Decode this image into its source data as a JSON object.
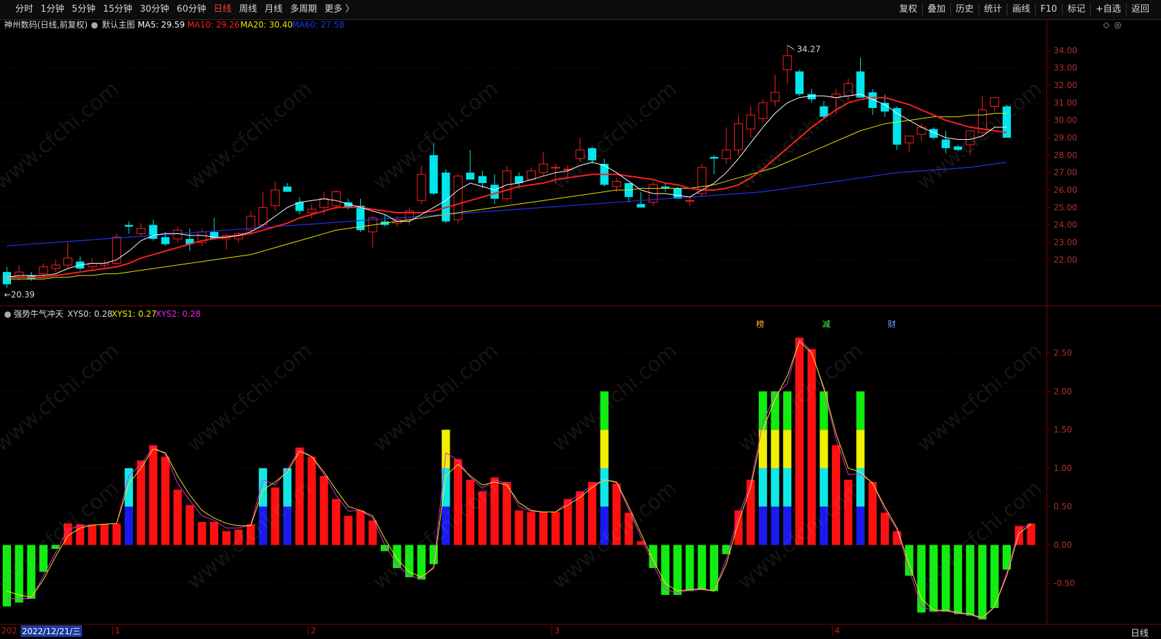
{
  "toolbar": {
    "periods": [
      "分时",
      "1分钟",
      "5分钟",
      "15分钟",
      "30分钟",
      "60分钟",
      "日线",
      "周线",
      "月线",
      "多周期",
      "更多 〉"
    ],
    "active_period": "日线",
    "tools": [
      "复权",
      "叠加",
      "历史",
      "统计",
      "画线",
      "F10",
      "标记",
      "+自选",
      "返回"
    ]
  },
  "main_legend": {
    "stock": "神州数码(日线,前复权)",
    "template": "默认主图",
    "ma5": "MA5: 29.59",
    "ma10": "MA10: 29.26",
    "ma20": "MA20: 30.40",
    "ma60": "MA60: 27.58"
  },
  "sub_legend": {
    "name": "强势牛气冲天",
    "xys0": "XYS0: 0.28",
    "xys1": "XYS1: 0.27",
    "xys2": "XYS2: 0.28"
  },
  "annotations": {
    "high": "34.27",
    "low": "20.39",
    "events": [
      "榜",
      "减",
      "财"
    ]
  },
  "bottom": {
    "date_label": "2022/12/21/三",
    "year_prefix": "202",
    "month_marks": [
      "1",
      "2",
      "3",
      "4"
    ],
    "period_label": "日线"
  },
  "watermark": "www.cfchi.com",
  "colors": {
    "up": "#ff2020",
    "down": "#00e5ee",
    "ma5": "#ffffff",
    "ma10": "#ff2020",
    "ma20": "#e8e800",
    "ma60": "#2233ee",
    "grid": "#6a0000"
  },
  "chart_data": [
    {
      "type": "candlestick",
      "title": "神州数码(日线,前复权)",
      "ylim": [
        20.0,
        35.0
      ],
      "yticks": [
        22.0,
        23.0,
        24.0,
        25.0,
        26.0,
        27.0,
        28.0,
        29.0,
        30.0,
        31.0,
        32.0,
        33.0,
        34.0
      ],
      "month_boundaries": [
        {
          "label": "1",
          "index": 9
        },
        {
          "label": "2",
          "index": 25
        },
        {
          "label": "3",
          "index": 45
        },
        {
          "label": "4",
          "index": 68
        }
      ],
      "ohlc": [
        [
          21.3,
          21.6,
          20.4,
          20.6
        ],
        [
          21.0,
          21.7,
          20.8,
          21.3
        ],
        [
          21.1,
          21.3,
          20.8,
          20.9
        ],
        [
          21.2,
          21.8,
          21.0,
          21.6
        ],
        [
          21.5,
          22.0,
          21.3,
          21.7
        ],
        [
          21.7,
          23.0,
          21.5,
          22.1
        ],
        [
          21.9,
          22.2,
          21.4,
          21.5
        ],
        [
          21.6,
          22.1,
          21.4,
          21.8
        ],
        [
          21.7,
          22.0,
          21.5,
          21.8
        ],
        [
          21.8,
          23.5,
          21.7,
          23.3
        ],
        [
          24.0,
          24.2,
          23.5,
          23.9
        ],
        [
          23.5,
          24.1,
          23.4,
          23.8
        ],
        [
          24.0,
          24.3,
          23.1,
          23.2
        ],
        [
          23.3,
          23.6,
          22.8,
          22.9
        ],
        [
          23.2,
          23.9,
          23.0,
          23.7
        ],
        [
          23.2,
          23.8,
          22.5,
          22.9
        ],
        [
          23.0,
          23.8,
          22.8,
          23.6
        ],
        [
          23.6,
          24.4,
          23.3,
          23.2
        ],
        [
          23.2,
          23.5,
          22.6,
          23.4
        ],
        [
          23.2,
          23.6,
          23.0,
          23.5
        ],
        [
          23.7,
          24.8,
          23.5,
          24.5
        ],
        [
          24.0,
          25.9,
          23.9,
          25.0
        ],
        [
          25.1,
          26.5,
          24.8,
          26.0
        ],
        [
          26.2,
          26.4,
          25.9,
          25.9
        ],
        [
          25.3,
          25.6,
          24.6,
          24.8
        ],
        [
          24.7,
          25.2,
          24.4,
          24.9
        ],
        [
          25.0,
          25.9,
          24.6,
          25.5
        ],
        [
          25.1,
          26.0,
          24.9,
          25.9
        ],
        [
          25.3,
          25.5,
          24.9,
          25.0
        ],
        [
          25.1,
          25.5,
          23.6,
          23.7
        ],
        [
          23.6,
          24.5,
          22.7,
          24.4
        ],
        [
          24.2,
          24.6,
          23.9,
          24.0
        ],
        [
          24.1,
          24.5,
          23.9,
          24.3
        ],
        [
          24.3,
          25.0,
          24.0,
          24.8
        ],
        [
          25.4,
          27.4,
          25.2,
          26.9
        ],
        [
          28.0,
          28.7,
          25.7,
          25.8
        ],
        [
          27.0,
          27.2,
          24.1,
          24.2
        ],
        [
          24.3,
          26.9,
          24.1,
          26.8
        ],
        [
          27.0,
          28.3,
          26.7,
          26.6
        ],
        [
          26.8,
          27.1,
          26.1,
          26.4
        ],
        [
          26.3,
          26.9,
          25.2,
          25.5
        ],
        [
          25.5,
          27.4,
          25.3,
          27.1
        ],
        [
          26.8,
          27.0,
          26.1,
          26.4
        ],
        [
          26.6,
          27.3,
          26.5,
          27.1
        ],
        [
          27.0,
          28.2,
          26.8,
          27.5
        ],
        [
          27.3,
          27.5,
          26.4,
          27.3
        ],
        [
          27.2,
          27.4,
          26.7,
          27.2
        ],
        [
          27.8,
          29.0,
          27.6,
          28.3
        ],
        [
          28.4,
          28.5,
          27.5,
          27.7
        ],
        [
          27.5,
          27.8,
          26.2,
          26.3
        ],
        [
          26.2,
          26.7,
          25.9,
          26.5
        ],
        [
          26.4,
          26.4,
          25.3,
          25.6
        ],
        [
          25.2,
          25.9,
          25.0,
          25.0
        ],
        [
          25.3,
          26.5,
          25.1,
          26.3
        ],
        [
          26.2,
          26.4,
          25.9,
          26.1
        ],
        [
          26.1,
          26.2,
          25.5,
          25.5
        ],
        [
          25.4,
          25.6,
          25.1,
          25.4
        ],
        [
          25.8,
          27.5,
          25.6,
          27.3
        ],
        [
          27.9,
          28.0,
          26.9,
          27.8
        ],
        [
          27.8,
          29.6,
          27.5,
          28.3
        ],
        [
          28.3,
          30.3,
          28.0,
          29.8
        ],
        [
          29.5,
          30.8,
          29.0,
          30.3
        ],
        [
          30.1,
          31.2,
          29.9,
          31.0
        ],
        [
          31.1,
          32.6,
          30.8,
          31.6
        ],
        [
          32.9,
          34.3,
          32.1,
          33.7
        ],
        [
          32.8,
          32.9,
          31.4,
          31.5
        ],
        [
          31.5,
          31.8,
          31.0,
          31.2
        ],
        [
          30.8,
          31.1,
          30.1,
          30.2
        ],
        [
          31.3,
          31.8,
          30.4,
          31.5
        ],
        [
          31.4,
          32.4,
          31.2,
          32.1
        ],
        [
          32.8,
          33.6,
          31.4,
          31.3
        ],
        [
          31.6,
          31.8,
          30.3,
          30.7
        ],
        [
          31.0,
          31.5,
          30.2,
          30.5
        ],
        [
          30.7,
          30.8,
          28.3,
          28.6
        ],
        [
          28.7,
          29.0,
          28.2,
          29.1
        ],
        [
          29.2,
          29.8,
          28.8,
          29.6
        ],
        [
          29.5,
          29.6,
          28.9,
          29.0
        ],
        [
          28.9,
          29.4,
          28.1,
          28.4
        ],
        [
          28.5,
          28.6,
          28.2,
          28.3
        ],
        [
          28.6,
          29.4,
          28.0,
          29.4
        ],
        [
          29.3,
          31.4,
          29.1,
          30.6
        ],
        [
          30.8,
          31.3,
          30.5,
          31.3
        ],
        [
          30.8,
          30.9,
          29.0,
          29.0
        ]
      ],
      "ma5": [
        21.0,
        21.1,
        21.1,
        21.1,
        21.2,
        21.5,
        21.7,
        21.8,
        21.8,
        22.0,
        22.5,
        23.1,
        23.4,
        23.5,
        23.5,
        23.4,
        23.4,
        23.3,
        23.3,
        23.4,
        23.6,
        24.0,
        24.5,
        25.0,
        25.3,
        25.4,
        25.5,
        25.4,
        25.2,
        25.0,
        24.8,
        24.6,
        24.2,
        24.2,
        24.6,
        25.0,
        25.4,
        26.0,
        26.4,
        26.2,
        26.0,
        26.3,
        26.4,
        26.6,
        26.8,
        27.0,
        27.1,
        27.4,
        27.6,
        27.4,
        27.0,
        26.5,
        26.0,
        25.8,
        25.8,
        25.7,
        25.6,
        26.0,
        26.4,
        27.0,
        27.8,
        28.7,
        29.6,
        30.4,
        31.0,
        31.3,
        31.4,
        31.4,
        31.3,
        31.4,
        31.5,
        31.2,
        30.9,
        30.4,
        30.0,
        29.6,
        29.3,
        29.0,
        28.9,
        28.9,
        29.1,
        29.6,
        29.6
      ],
      "ma10": [
        21.0,
        21.0,
        21.0,
        21.0,
        21.1,
        21.2,
        21.3,
        21.4,
        21.5,
        21.6,
        21.8,
        22.1,
        22.3,
        22.5,
        22.7,
        22.9,
        23.1,
        23.2,
        23.3,
        23.4,
        23.5,
        23.7,
        23.9,
        24.1,
        24.4,
        24.6,
        24.8,
        25.0,
        25.0,
        25.0,
        24.9,
        24.8,
        24.7,
        24.7,
        24.7,
        24.8,
        25.0,
        25.2,
        25.4,
        25.6,
        25.8,
        26.0,
        26.2,
        26.3,
        26.4,
        26.6,
        26.7,
        26.8,
        26.9,
        26.9,
        26.9,
        26.8,
        26.7,
        26.6,
        26.4,
        26.3,
        26.1,
        26.0,
        26.0,
        26.1,
        26.3,
        26.7,
        27.2,
        27.8,
        28.4,
        29.0,
        29.6,
        30.1,
        30.6,
        31.0,
        31.2,
        31.3,
        31.3,
        31.1,
        30.9,
        30.6,
        30.3,
        30.0,
        29.8,
        29.6,
        29.5,
        29.4,
        29.3
      ],
      "ma20": [
        20.9,
        20.9,
        20.9,
        20.9,
        21.0,
        21.0,
        21.1,
        21.1,
        21.2,
        21.2,
        21.3,
        21.4,
        21.5,
        21.6,
        21.7,
        21.8,
        21.9,
        22.0,
        22.1,
        22.2,
        22.3,
        22.5,
        22.7,
        22.9,
        23.1,
        23.3,
        23.5,
        23.7,
        23.8,
        23.9,
        24.0,
        24.1,
        24.2,
        24.3,
        24.4,
        24.5,
        24.6,
        24.7,
        24.8,
        24.9,
        25.0,
        25.1,
        25.2,
        25.3,
        25.4,
        25.5,
        25.6,
        25.7,
        25.8,
        25.9,
        26.0,
        26.0,
        26.1,
        26.1,
        26.1,
        26.1,
        26.1,
        26.2,
        26.3,
        26.5,
        26.7,
        26.9,
        27.1,
        27.3,
        27.6,
        27.9,
        28.2,
        28.5,
        28.8,
        29.1,
        29.4,
        29.6,
        29.8,
        29.9,
        30.0,
        30.1,
        30.2,
        30.2,
        30.2,
        30.3,
        30.3,
        30.4,
        30.4
      ],
      "ma60": [
        22.8,
        22.85,
        22.9,
        22.95,
        23.0,
        23.05,
        23.1,
        23.15,
        23.2,
        23.25,
        23.3,
        23.35,
        23.4,
        23.45,
        23.5,
        23.55,
        23.6,
        23.65,
        23.7,
        23.75,
        23.8,
        23.85,
        23.9,
        23.95,
        24.0,
        24.05,
        24.1,
        24.15,
        24.2,
        24.25,
        24.3,
        24.35,
        24.4,
        24.45,
        24.5,
        24.55,
        24.6,
        24.65,
        24.7,
        24.75,
        24.8,
        24.85,
        24.9,
        24.95,
        25.0,
        25.05,
        25.1,
        25.15,
        25.2,
        25.25,
        25.3,
        25.35,
        25.4,
        25.45,
        25.5,
        25.55,
        25.6,
        25.65,
        25.7,
        25.75,
        25.8,
        25.85,
        25.9,
        26.0,
        26.1,
        26.2,
        26.3,
        26.4,
        26.5,
        26.6,
        26.7,
        26.8,
        26.9,
        27.0,
        27.05,
        27.1,
        27.15,
        27.2,
        27.25,
        27.3,
        27.4,
        27.5,
        27.58
      ]
    },
    {
      "type": "bar",
      "title": "强势牛气冲天",
      "ylim": [
        -1.0,
        2.9
      ],
      "yticks": [
        -0.5,
        0.0,
        0.5,
        1.0,
        1.5,
        2.0,
        2.5
      ],
      "xys0": [
        -0.8,
        -0.75,
        -0.7,
        -0.35,
        -0.05,
        0.28,
        0.27,
        0.26,
        0.27,
        0.28,
        1.0,
        1.1,
        1.3,
        1.15,
        0.72,
        0.52,
        0.3,
        0.3,
        0.18,
        0.2,
        0.27,
        1.0,
        0.75,
        1.0,
        1.27,
        1.15,
        0.9,
        0.6,
        0.38,
        0.45,
        0.32,
        -0.08,
        -0.3,
        -0.42,
        -0.45,
        -0.25,
        1.5,
        1.12,
        0.85,
        0.7,
        0.88,
        0.82,
        0.45,
        0.43,
        0.43,
        0.43,
        0.6,
        0.7,
        0.82,
        2.0,
        0.8,
        0.42,
        0.05,
        -0.3,
        -0.65,
        -0.65,
        -0.6,
        -0.58,
        -0.6,
        -0.12,
        0.45,
        0.85,
        2.0,
        2.0,
        2.0,
        2.7,
        2.55,
        2.0,
        1.3,
        0.85,
        2.0,
        0.82,
        0.42,
        0.18,
        -0.4,
        -0.88,
        -0.87,
        -0.87,
        -0.9,
        -0.92,
        -0.97,
        -0.82,
        -0.32,
        0.25,
        0.28
      ],
      "xys1": [
        -0.6,
        -0.65,
        -0.68,
        -0.45,
        -0.15,
        0.12,
        0.22,
        0.26,
        0.27,
        0.28,
        0.8,
        1.0,
        1.25,
        1.2,
        0.9,
        0.65,
        0.45,
        0.35,
        0.28,
        0.25,
        0.25,
        0.72,
        0.82,
        0.95,
        1.22,
        1.15,
        0.95,
        0.72,
        0.5,
        0.45,
        0.38,
        0.08,
        -0.18,
        -0.35,
        -0.42,
        -0.3,
        0.9,
        1.05,
        0.9,
        0.78,
        0.82,
        0.78,
        0.55,
        0.45,
        0.43,
        0.43,
        0.52,
        0.62,
        0.75,
        0.85,
        0.82,
        0.5,
        0.15,
        -0.2,
        -0.5,
        -0.6,
        -0.58,
        -0.57,
        -0.6,
        -0.25,
        0.3,
        0.75,
        1.5,
        1.9,
        2.2,
        2.65,
        2.5,
        2.05,
        1.45,
        1.0,
        0.95,
        0.8,
        0.5,
        0.22,
        -0.25,
        -0.7,
        -0.85,
        -0.85,
        -0.88,
        -0.9,
        -0.95,
        -0.8,
        -0.4,
        0.15,
        0.27
      ],
      "xys2": [
        -0.7,
        -0.7,
        -0.7,
        -0.4,
        -0.1,
        0.2,
        0.25,
        0.26,
        0.27,
        0.28,
        0.9,
        1.05,
        1.28,
        1.18,
        0.8,
        0.58,
        0.38,
        0.32,
        0.22,
        0.22,
        0.26,
        0.85,
        0.78,
        0.98,
        1.25,
        1.15,
        0.92,
        0.65,
        0.44,
        0.45,
        0.35,
        0.0,
        -0.25,
        -0.4,
        -0.44,
        -0.28,
        1.2,
        1.1,
        0.88,
        0.74,
        0.85,
        0.8,
        0.5,
        0.44,
        0.43,
        0.43,
        0.56,
        0.66,
        0.78,
        0.85,
        0.81,
        0.46,
        0.1,
        -0.25,
        -0.58,
        -0.62,
        -0.59,
        -0.58,
        -0.6,
        -0.18,
        0.38,
        0.8,
        1.6,
        1.95,
        2.1,
        2.68,
        2.52,
        2.02,
        1.38,
        0.92,
        0.92,
        0.81,
        0.46,
        0.2,
        -0.32,
        -0.8,
        -0.86,
        -0.86,
        -0.89,
        -0.91,
        -0.96,
        -0.81,
        -0.36,
        0.2,
        0.28
      ]
    }
  ]
}
